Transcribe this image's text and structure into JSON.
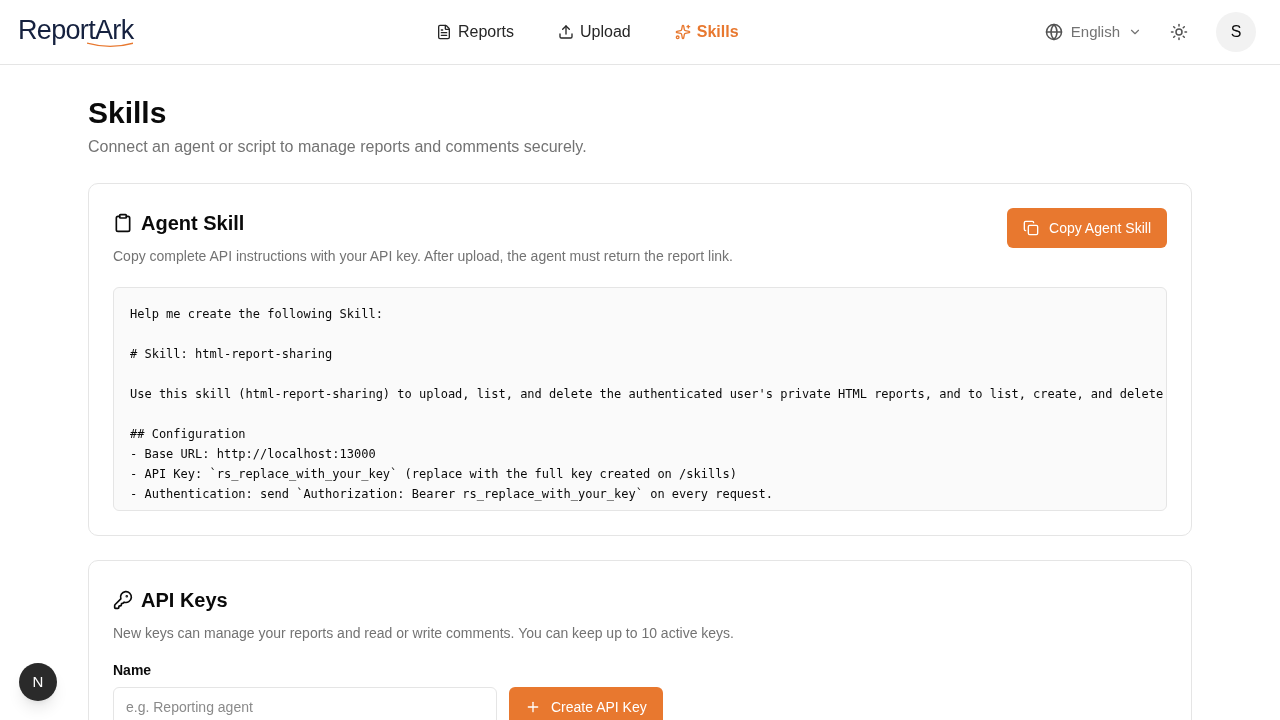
{
  "header": {
    "logo": "ReportArk",
    "nav": [
      {
        "label": "Reports",
        "selected": false
      },
      {
        "label": "Upload",
        "selected": false
      },
      {
        "label": "Skills",
        "selected": true
      }
    ],
    "language": "English",
    "avatar": "S"
  },
  "page": {
    "title": "Skills",
    "subtitle": "Connect an agent or script to manage reports and comments securely."
  },
  "agent_skill": {
    "title": "Agent Skill",
    "description": "Copy complete API instructions with your API key. After upload, the agent must return the report link.",
    "copy_button": "Copy Agent Skill",
    "code_blocks": [
      [
        "Help me create the following Skill:"
      ],
      [
        "# Skill: html-report-sharing"
      ],
      [
        "Use this skill (html-report-sharing) to upload, list, and delete the authenticated user's private HTML reports, and to list, create, and delete"
      ],
      [
        "## Configuration",
        "- Base URL: http://localhost:13000",
        "- API Key: `rs_replace_with_your_key` (replace with the full key created on /skills)",
        "- Authentication: send `Authorization: Bearer rs_replace_with_your_key` on every request."
      ]
    ]
  },
  "api_keys": {
    "title": "API Keys",
    "description": "New keys can manage your reports and read or write comments. You can keep up to 10 active keys.",
    "name_label": "Name",
    "name_placeholder": "e.g. Reporting agent",
    "create_button": "Create API Key"
  },
  "dev_badge": "N"
}
